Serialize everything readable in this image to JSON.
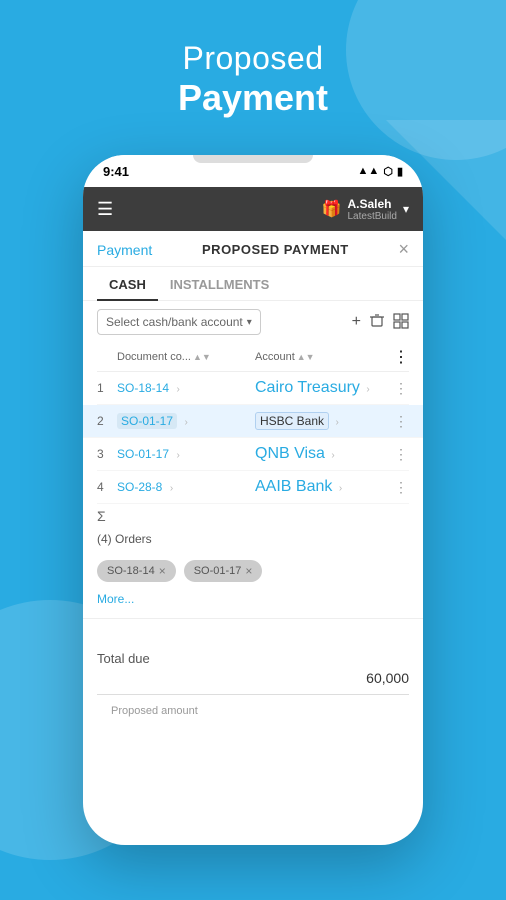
{
  "background": {
    "color": "#29ABE2"
  },
  "page_header": {
    "line1": "Proposed",
    "line2": "Payment"
  },
  "status_bar": {
    "time": "9:41",
    "icons": "▲▲ ⬡ ▮"
  },
  "navbar": {
    "menu_icon": "☰",
    "gift_icon": "🎁",
    "user_name": "A.Saleh",
    "user_build": "LatestBuild",
    "chevron": "▾"
  },
  "payment_header": {
    "back_label": "Payment",
    "title": "PROPOSED PAYMENT",
    "close": "×"
  },
  "tabs": [
    {
      "label": "CASH",
      "active": true
    },
    {
      "label": "INSTALLMENTS",
      "active": false
    }
  ],
  "toolbar": {
    "select_placeholder": "Select cash/bank account",
    "add_btn": "+",
    "delete_btn": "🗑",
    "grid_btn": "⊞"
  },
  "table": {
    "headers": {
      "num": "",
      "doc": "Document co...",
      "account": "Account",
      "more": "⋮"
    },
    "rows": [
      {
        "num": "1",
        "doc": "SO-18-14",
        "account": "Cairo Treasury",
        "highlighted": false
      },
      {
        "num": "2",
        "doc": "SO-01-17",
        "account": "HSBC Bank",
        "highlighted": true
      },
      {
        "num": "3",
        "doc": "SO-01-17",
        "account": "QNB Visa",
        "highlighted": false
      },
      {
        "num": "4",
        "doc": "SO-28-8",
        "account": "AAIB Bank",
        "highlighted": false
      }
    ],
    "sigma": "Σ"
  },
  "orders": {
    "label": "(4) Orders"
  },
  "tags": [
    {
      "label": "SO-18-14"
    },
    {
      "label": "SO-01-17"
    }
  ],
  "more_label": "More...",
  "totals": {
    "total_due_label": "Total due",
    "total_due_value": "60,000",
    "proposed_label": "Proposed amount"
  }
}
